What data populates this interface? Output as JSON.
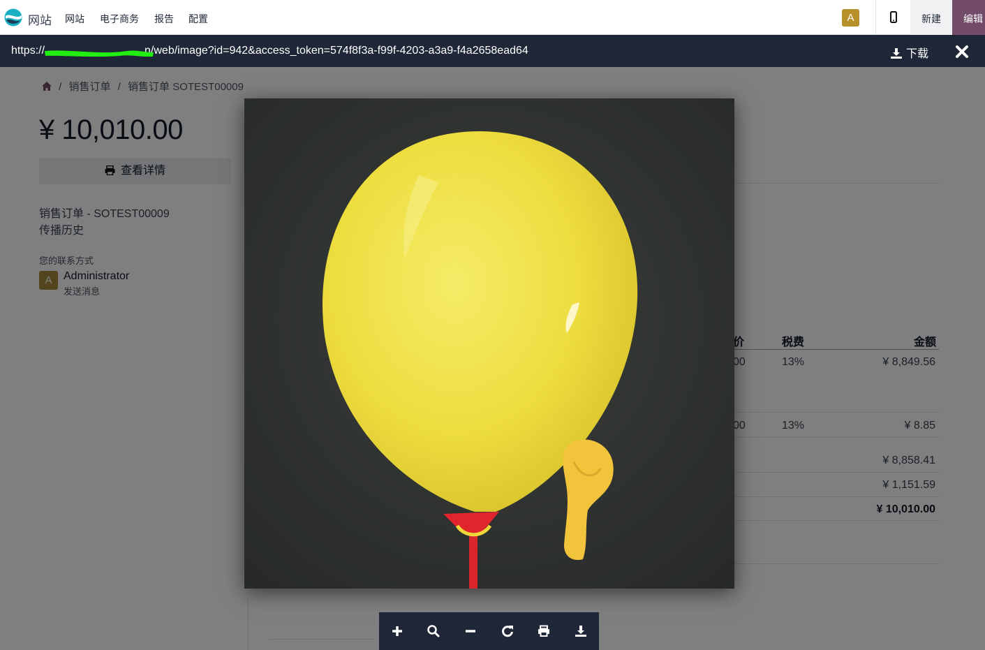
{
  "navbar": {
    "brand": "网站",
    "menu": [
      "网站",
      "电子商务",
      "报告",
      "配置"
    ],
    "user_initial": "A",
    "new_label": "新建",
    "edit_label": "编辑"
  },
  "viewer": {
    "url_prefix": "https://",
    "url_suffix": "n/web/image?id=942&access_token=574f8f3a-f99f-4203-a3a9-f4a2658ead64",
    "download_label": "下载"
  },
  "page": {
    "breadcrumb": [
      "销售订单",
      "销售订单 SOTEST00009"
    ],
    "price": "¥ 10,010.00",
    "details_label": "查看详情",
    "order_line": "销售订单 - SOTEST00009",
    "history_line": "传播历史",
    "contact_label": "您的联系方式",
    "contact_initial": "A",
    "contact_name": "Administrator",
    "contact_msg": "发送消息",
    "table": {
      "headers": [
        "价",
        "税费",
        "金额"
      ],
      "rows": [
        {
          "unit_frag": "00",
          "tax": "13%",
          "amount": "¥ 8,849.56"
        },
        {
          "unit_frag": "00",
          "tax": "13%",
          "amount": "¥ 8.85"
        }
      ],
      "untaxed": "¥ 8,858.41",
      "tax_total": "¥ 1,151.59",
      "total": "¥ 10,010.00"
    }
  },
  "colors": {
    "viewer_bar": "#1e2637",
    "edit_button": "#714b67",
    "avatar": "#b8902a",
    "redaction": "#22ee11"
  },
  "icons": [
    "home-icon",
    "printer-icon",
    "download-icon",
    "close-icon",
    "mobile-icon",
    "zoom-in-icon",
    "zoom-reset-icon",
    "zoom-out-icon",
    "rotate-icon",
    "print-icon"
  ]
}
